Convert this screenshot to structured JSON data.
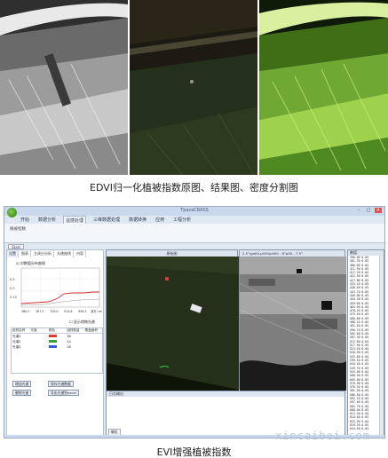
{
  "figure": {
    "caption_top": "EDVI归一化植被指数原图、结果图、密度分割图",
    "caption_bottom": "EVI增强植被指数",
    "watermark": "xincaibei.com"
  },
  "window": {
    "title": "TpaceCRASS",
    "controls": [
      "–",
      "□",
      "×"
    ]
  },
  "menu": {
    "items": [
      "开始",
      "数据分析",
      "遥感处理",
      "三维数据处理",
      "数据转换",
      "应用",
      "工程分析"
    ],
    "active_index": 2
  },
  "ribbon": {
    "label": "植被指数"
  },
  "document_tab": "Start",
  "left_panel": {
    "tabs": [
      "设置",
      "图表",
      "主成分分析",
      "光谱曲线",
      "内容"
    ],
    "checkbox_label": "☑ 对数值分布曲线",
    "y_ticks": [
      "0.5",
      "0.3",
      "0.15"
    ],
    "x_ticks": [
      "360.2",
      "387.5",
      "720.0",
      "914.6",
      "958.3"
    ],
    "x_unit": "波长 nm",
    "checkbox2_label": "☐ 显示地物光谱",
    "table": {
      "headers": [
        "组别名称",
        "光谱",
        "颜色",
        "组别数量",
        "覆盖面积"
      ],
      "rows": [
        {
          "name": "光谱1",
          "color": "#e03a2f",
          "count": "36"
        },
        {
          "name": "光谱2",
          "color": "#2fa63a",
          "count": "24"
        },
        {
          "name": "光谱3",
          "color": "#2f5fd6",
          "count": "18"
        }
      ]
    },
    "buttons": [
      "增加光谱",
      "删除光谱",
      "保存光谱数据",
      "导出光谱到excel"
    ]
  },
  "center_viewer": {
    "title": "原始图"
  },
  "right_viewer": {
    "title": "2.5°/gd00-p000/p000 - 6°p00 - 7.5°"
  },
  "value_list": {
    "title": "数值",
    "rows": [
      "396.00  0.05",
      "401.30  0.05",
      "406.60  0.05",
      "411.90  0.05",
      "417.20  0.05",
      "422.50  0.05",
      "427.80  0.05",
      "433.10  0.05",
      "438.40  0.05",
      "443.70  0.05",
      "449.00  0.05",
      "454.30  0.05",
      "459.60  0.05",
      "464.90  0.05",
      "470.20  0.05",
      "475.50  0.05",
      "480.80  0.05",
      "486.10  0.05",
      "491.40  0.05",
      "496.70  0.05",
      "502.00  0.05",
      "507.30  0.05",
      "512.60  0.05",
      "517.90  0.05",
      "523.20  0.05",
      "528.50  0.05",
      "533.80  0.05",
      "539.10  0.05",
      "544.40  0.05",
      "549.70  0.05",
      "555.00  0.05",
      "560.30  0.05",
      "565.60  0.05",
      "570.90  0.05",
      "576.20  0.05",
      "581.50  0.05",
      "586.80  0.05",
      "592.10  0.05",
      "597.40  0.05",
      "602.70  0.05",
      "608.00  0.05",
      "613.30  0.05",
      "618.60  0.05",
      "623.90  0.05",
      "629.20  0.05",
      "634.50  0.05"
    ]
  },
  "output": {
    "title": "日志输出",
    "tab": "输出"
  }
}
